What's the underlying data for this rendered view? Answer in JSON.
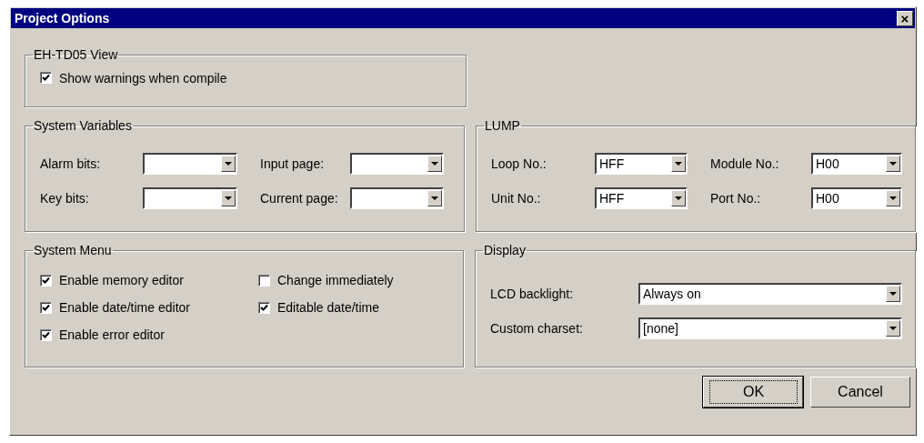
{
  "window": {
    "title": "Project Options",
    "close": "×"
  },
  "view_group": {
    "title": "EH-TD05 View",
    "options": [
      {
        "label": "Show warnings when compile",
        "checked": true
      }
    ]
  },
  "system_variables": {
    "title": "System Variables",
    "fields": [
      {
        "label": "Alarm bits:"
      },
      {
        "label": "Input page:"
      },
      {
        "label": "Key bits:"
      },
      {
        "label": "Current page:"
      }
    ]
  },
  "lump": {
    "title": "LUMP",
    "fields": [
      {
        "label": "Loop No.:",
        "value": "HFF"
      },
      {
        "label": "Module No.:",
        "value": "H00"
      },
      {
        "label": "Unit No.:",
        "value": "HFF"
      },
      {
        "label": "Port No.:",
        "value": "H00"
      }
    ]
  },
  "system_menu": {
    "title": "System Menu",
    "options": [
      {
        "label": "Enable memory editor",
        "checked": true
      },
      {
        "label": "Change immediately",
        "checked": false
      },
      {
        "label": "Enable date/time editor",
        "checked": true
      },
      {
        "label": "Editable date/time",
        "checked": true
      },
      {
        "label": "Enable error editor",
        "checked": true
      }
    ]
  },
  "display": {
    "title": "Display",
    "fields": [
      {
        "label": "LCD backlight:",
        "value": "Always on"
      },
      {
        "label": "Custom charset:",
        "value": "[none]"
      }
    ]
  },
  "buttons": [
    {
      "label": "OK",
      "default": true
    },
    {
      "label": "Cancel",
      "default": false
    }
  ]
}
